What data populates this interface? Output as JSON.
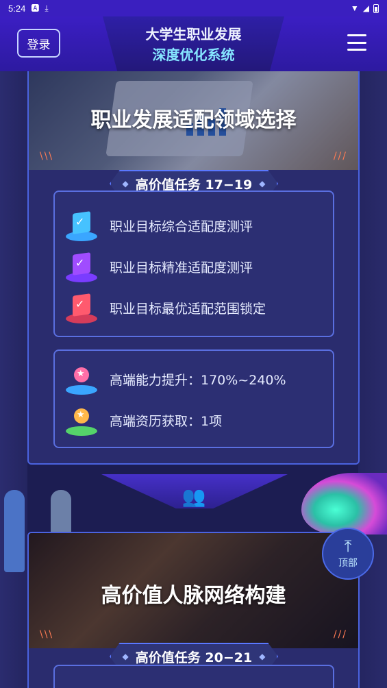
{
  "status_bar": {
    "time": "5:24",
    "left_icons": [
      "notification-a-icon",
      "download-icon"
    ],
    "right_icons": [
      "wifi-icon",
      "signal-icon",
      "battery-icon"
    ]
  },
  "header": {
    "login_label": "登录",
    "title_line1": "大学生职业发展",
    "title_line2": "深度优化系统",
    "menu_icon": "hamburger-menu-icon"
  },
  "section1": {
    "hero_title": "职业发展适配领域选择",
    "ribbon_label": "高价值任务 17−19",
    "tasks": [
      {
        "label": "职业目标综合适配度测评",
        "icon": "book-check-icon",
        "color": "#3aa6ff"
      },
      {
        "label": "职业目标精准适配度测评",
        "icon": "book-check-icon",
        "color": "#a04cff"
      },
      {
        "label": "职业目标最优适配范围锁定",
        "icon": "book-check-icon",
        "color": "#ff5a6e"
      }
    ],
    "rewards": [
      {
        "label": "高端能力提升：170%~240%",
        "icon": "medal-star-icon",
        "color": "#3aa6ff"
      },
      {
        "label": "高端资历获取：1项",
        "icon": "medal-star-icon",
        "color": "#55d36a"
      }
    ]
  },
  "section2": {
    "hero_title": "高价值人脉网络构建",
    "ribbon_label": "高价值任务 20−21",
    "connector_icon": "people-icon"
  },
  "to_top": {
    "label": "顶部",
    "icon": "arrow-up-icon"
  },
  "colors": {
    "status_bar": "#3a1fbf",
    "title_accent": "#86e6ff",
    "card_border": "#4b63e0",
    "background": "#1c1d52"
  }
}
